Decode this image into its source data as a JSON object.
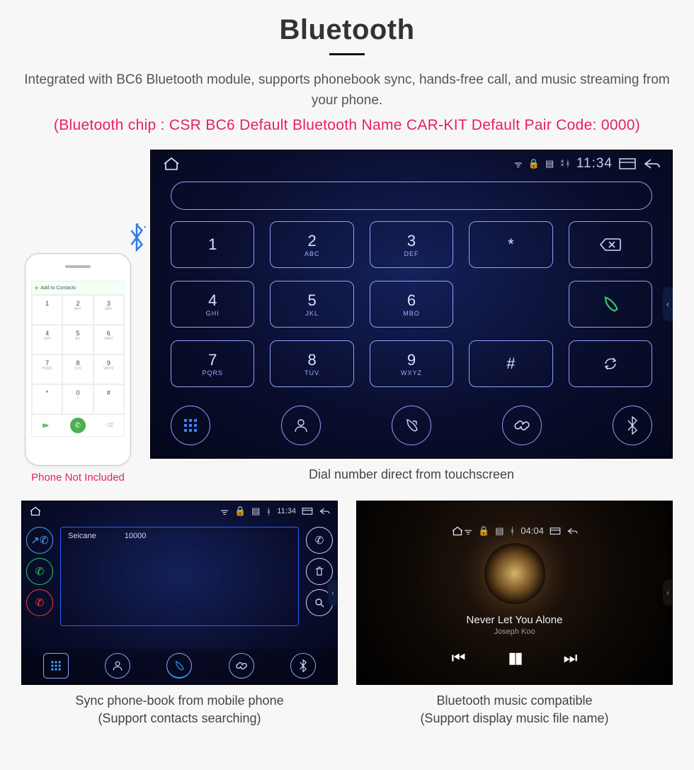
{
  "header": {
    "title": "Bluetooth",
    "description": "Integrated with BC6 Bluetooth module, supports phonebook sync, hands-free call, and music streaming from your phone.",
    "spec": "(Bluetooth chip : CSR BC6    Default Bluetooth Name CAR-KIT    Default Pair Code: 0000)"
  },
  "phone": {
    "addContact": "Add to Contacts",
    "caption": "Phone Not Included",
    "keys": [
      {
        "n": "1",
        "s": ""
      },
      {
        "n": "2",
        "s": "ABC"
      },
      {
        "n": "3",
        "s": "DEF"
      },
      {
        "n": "4",
        "s": "GHI"
      },
      {
        "n": "5",
        "s": "JKL"
      },
      {
        "n": "6",
        "s": "MNO"
      },
      {
        "n": "7",
        "s": "PQRS"
      },
      {
        "n": "8",
        "s": "TUV"
      },
      {
        "n": "9",
        "s": "WXYZ"
      },
      {
        "n": "*",
        "s": ""
      },
      {
        "n": "0",
        "s": "+"
      },
      {
        "n": "#",
        "s": ""
      }
    ]
  },
  "unit": {
    "time": "11:34",
    "keys": [
      {
        "n": "1",
        "s": ""
      },
      {
        "n": "2",
        "s": "ABC"
      },
      {
        "n": "3",
        "s": "DEF"
      },
      {
        "n": "*",
        "s": ""
      },
      {
        "n": "⌫",
        "s": "",
        "kind": "del"
      },
      {
        "n": "4",
        "s": "GHI"
      },
      {
        "n": "5",
        "s": "JKL"
      },
      {
        "n": "6",
        "s": "MBO"
      },
      {
        "n": "",
        "s": "",
        "blank": true
      },
      {
        "n": "call",
        "s": "",
        "kind": "call"
      },
      {
        "n": "7",
        "s": "PQRS"
      },
      {
        "n": "8",
        "s": "TUV"
      },
      {
        "n": "9",
        "s": "WXYZ"
      },
      {
        "n": "#",
        "s": ""
      },
      {
        "n": "swap",
        "s": "",
        "kind": "swap"
      }
    ],
    "caption": "Dial number direct from touchscreen"
  },
  "phonebook": {
    "time": "11:34",
    "contact": {
      "name": "Seicane",
      "number": "10000"
    },
    "caption1": "Sync phone-book from mobile phone",
    "caption2": "(Support contacts searching)"
  },
  "music": {
    "time": "04:04",
    "song": "Never Let You Alone",
    "artist": "Joseph Koo",
    "caption1": "Bluetooth music compatible",
    "caption2": "(Support display music file name)"
  }
}
